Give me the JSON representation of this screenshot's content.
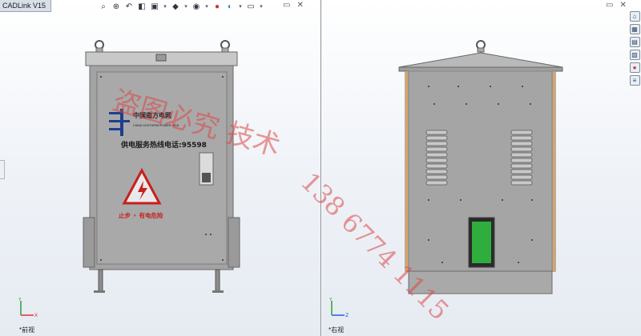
{
  "app": {
    "title": "CADLink V15"
  },
  "toolbar_icons": [
    "zoom-fit-icon",
    "zoom-area-icon",
    "previous-view-icon",
    "section-view-icon",
    "view-orientation-icon",
    "display-style-icon",
    "hide-show-icon",
    "edit-appearance-icon",
    "scene-icon",
    "view-settings-icon"
  ],
  "window_controls": {
    "restore": "▭",
    "close": "✕"
  },
  "task_pane_icons": [
    "home-icon",
    "resources-icon",
    "library-icon",
    "explorer-icon",
    "appearances-icon",
    "properties-icon"
  ],
  "views": {
    "left": {
      "label": "*前视"
    },
    "right": {
      "label": "*右视"
    }
  },
  "cabinet_front": {
    "brand_cn": "中国南方电网",
    "brand_en": "CHINA SOUTHERN POWER GRID",
    "hotline": "供电服务热线电话:95598",
    "warning": "止步 ⚡ 有电危险"
  },
  "watermark": {
    "line1": "盗图必究 技术",
    "line2": "138 6774 1115"
  },
  "colors": {
    "accent_red": "#c81e1e",
    "logo_blue": "#1d3f8f",
    "vent_green": "#2fae3e",
    "panel_gray": "#9c9c9c"
  }
}
